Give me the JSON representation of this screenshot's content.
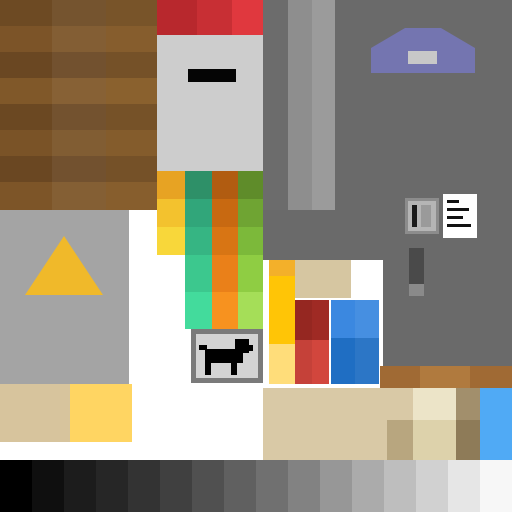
{
  "atlas": {
    "kind": "texture-atlas",
    "tiles": [
      {
        "name": "oak-planks-tile"
      },
      {
        "name": "red-wool-tile"
      },
      {
        "name": "iron-block-tile"
      },
      {
        "name": "stone-gray-tile"
      },
      {
        "name": "camper-roof-icon"
      },
      {
        "name": "yellow-warning-triangle-icon"
      },
      {
        "name": "color-swatches-tile"
      },
      {
        "name": "dog-sign-icon"
      },
      {
        "name": "building-blocks-tile"
      },
      {
        "name": "control-panel-icon"
      },
      {
        "name": "grayscale-palette-strip"
      }
    ]
  },
  "colors": {
    "wood_dark": "#6b4a22",
    "wood_mid": "#8a5f2c",
    "wood_light": "#9b6e35",
    "red": "#d8323a",
    "iron": "#cfcfcf",
    "stone": "#6f6f6f",
    "stone_stripe": "#999999",
    "roof_purple": "#7475b0",
    "warning_yellow": "#f0b92a",
    "sky_blue": "#50aaf5"
  },
  "grayscale": [
    "#000000",
    "#0f0f0f",
    "#1c1c1c",
    "#262626",
    "#333333",
    "#404040",
    "#505050",
    "#606060",
    "#707070",
    "#828282",
    "#979797",
    "#ababab",
    "#bebebe",
    "#d1d1d1",
    "#e6e6e6",
    "#f7f7f7"
  ]
}
